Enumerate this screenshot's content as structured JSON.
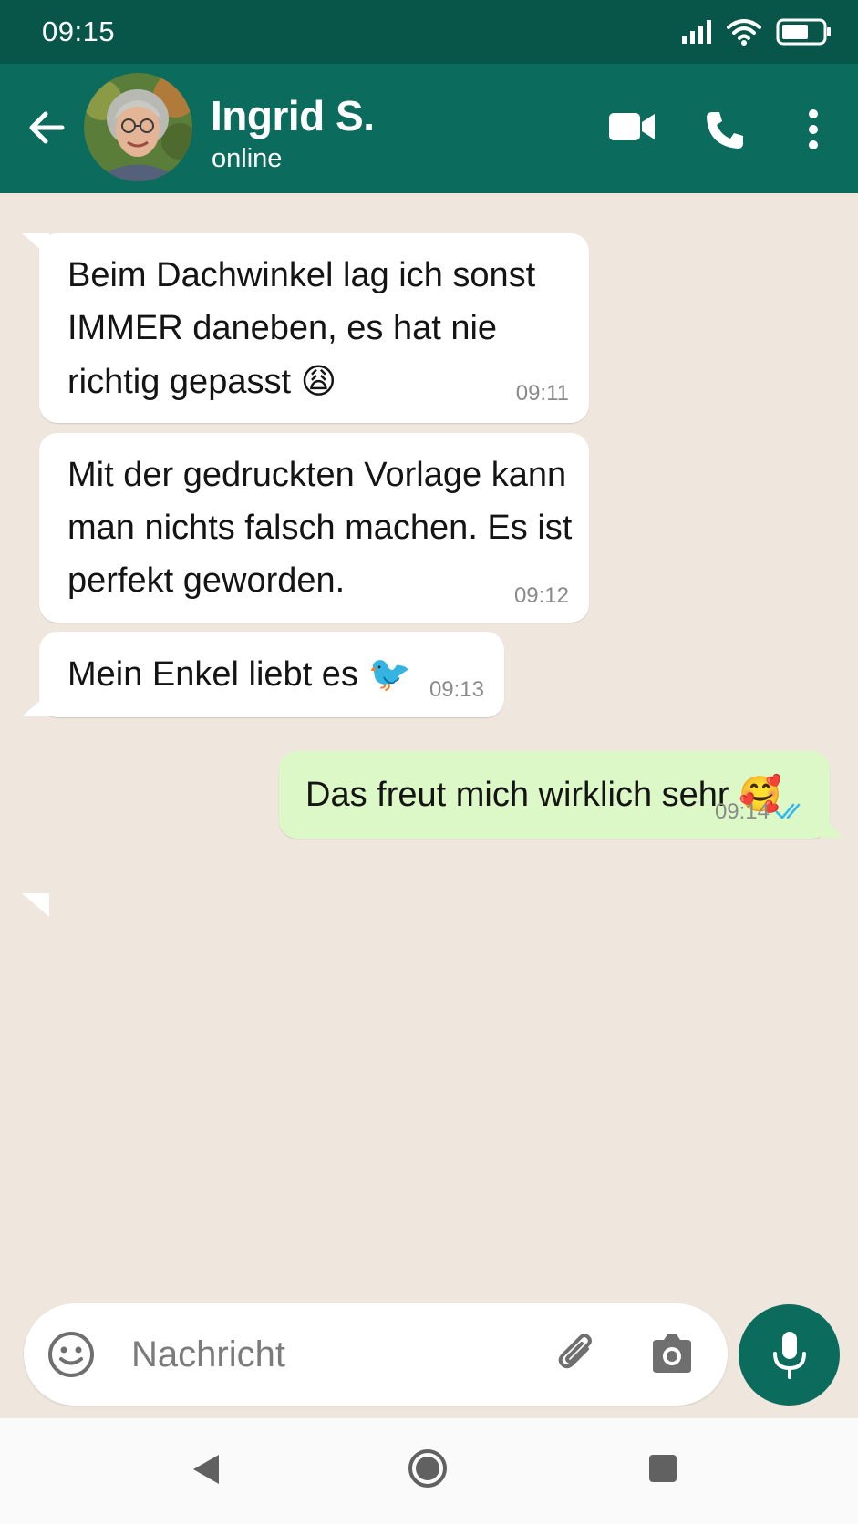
{
  "status_bar": {
    "time": "09:15"
  },
  "header": {
    "contact_name": "Ingrid S.",
    "contact_status": "online"
  },
  "messages": [
    {
      "direction": "incoming",
      "lines": [
        "Beim Dachwinkel lag ich sonst",
        "IMMER daneben, es hat nie",
        "richtig gepasst"
      ],
      "emoji": "😩",
      "time": "09:11"
    },
    {
      "direction": "incoming",
      "lines": [
        "Mit der gedruckten Vorlage kann",
        "man nichts falsch machen. Es ist",
        "perfekt geworden."
      ],
      "time": "09:12"
    },
    {
      "direction": "incoming",
      "lines": [
        "Mein Enkel liebt es"
      ],
      "emoji": "🐦",
      "time": "09:13"
    },
    {
      "direction": "outgoing",
      "lines": [
        "Das freut mich wirklich sehr"
      ],
      "emoji": "🥰",
      "time": "09:14",
      "receipt": "read"
    }
  ],
  "input": {
    "placeholder": "Nachricht"
  },
  "icons": {
    "back": "arrow-left-icon",
    "video": "video-camera-icon",
    "call": "phone-icon",
    "menu": "more-vertical-icon",
    "emoji": "smiley-icon",
    "attach": "paperclip-icon",
    "camera": "camera-icon",
    "mic": "microphone-icon",
    "signal": "signal-icon",
    "wifi": "wifi-icon",
    "battery": "battery-icon"
  },
  "colors": {
    "status_bar": "#08554a",
    "header": "#0b6b5c",
    "chat_bg": "#efe6dd",
    "incoming_bubble": "#ffffff",
    "outgoing_bubble": "#dcf8c6",
    "read_ticks": "#34b7f1"
  }
}
